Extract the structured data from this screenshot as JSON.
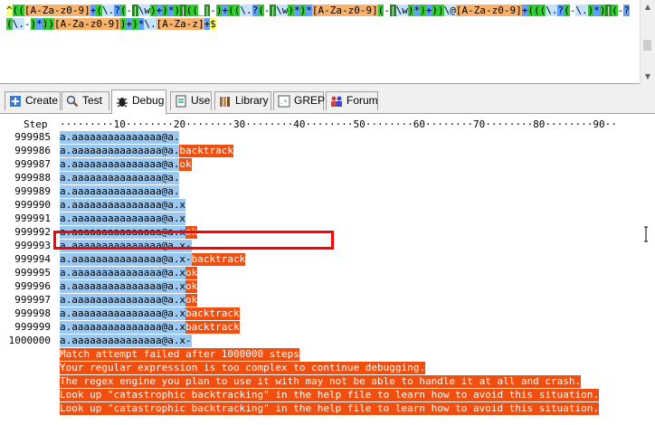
{
  "regex": {
    "tokens": [
      {
        "t": "^",
        "c": "t-anchor"
      },
      {
        "t": "(",
        "c": "t-grp"
      },
      {
        "t": "(",
        "c": "t-grp"
      },
      {
        "t": "[A-Za-z0-9]",
        "c": "t-cls"
      },
      {
        "t": "+",
        "c": "t-q"
      },
      {
        "t": "(",
        "c": "t-grp"
      },
      {
        "t": "\\.",
        "c": "t-esc"
      },
      {
        "t": "?",
        "c": "t-q"
      },
      {
        "t": "(",
        "c": "t-grp"
      },
      {
        "t": "-",
        "c": "t-lit"
      },
      {
        "t": "|",
        "c": "t-alt"
      },
      {
        "t": "\\w",
        "c": "t-esc"
      },
      {
        "t": ")",
        "c": "t-grp"
      },
      {
        "t": "+",
        "c": "t-q"
      },
      {
        "t": ")",
        "c": "t-grp"
      },
      {
        "t": "*",
        "c": "t-q"
      },
      {
        "t": ")",
        "c": "t-grp"
      },
      {
        "t": "|",
        "c": "t-alt"
      },
      {
        "t": "(",
        "c": "t-grp"
      },
      {
        "t": "(",
        "c": "t-grp"
      },
      {
        "t": "_",
        "c": "t-lit"
      },
      {
        "t": "|",
        "c": "t-alt"
      },
      {
        "t": "-",
        "c": "t-lit"
      },
      {
        "t": ")",
        "c": "t-grp"
      },
      {
        "t": "+",
        "c": "t-q"
      },
      {
        "t": "(",
        "c": "t-grp"
      },
      {
        "t": "(",
        "c": "t-grp"
      },
      {
        "t": "\\.",
        "c": "t-esc"
      },
      {
        "t": "?",
        "c": "t-q"
      },
      {
        "t": "(",
        "c": "t-grp"
      },
      {
        "t": "-",
        "c": "t-lit"
      },
      {
        "t": "|",
        "c": "t-alt"
      },
      {
        "t": "\\w",
        "c": "t-esc"
      },
      {
        "t": ")",
        "c": "t-grp"
      },
      {
        "t": "*",
        "c": "t-q"
      },
      {
        "t": ")",
        "c": "t-grp"
      },
      {
        "t": "*",
        "c": "t-q"
      },
      {
        "t": "[A-Za-z0-9]",
        "c": "t-cls"
      },
      {
        "t": "(",
        "c": "t-grp"
      },
      {
        "t": "-",
        "c": "t-lit"
      },
      {
        "t": "|",
        "c": "t-alt"
      },
      {
        "t": "\\w",
        "c": "t-esc"
      },
      {
        "t": ")",
        "c": "t-grp"
      },
      {
        "t": "*",
        "c": "t-q"
      },
      {
        "t": ")",
        "c": "t-grp"
      },
      {
        "t": "+",
        "c": "t-q"
      },
      {
        "t": ")",
        "c": "t-grp"
      },
      {
        "t": ")",
        "c": "t-grp"
      },
      {
        "t": "\\@",
        "c": "t-esc"
      },
      {
        "t": "[A-Za-z0-9]",
        "c": "t-cls"
      },
      {
        "t": "+",
        "c": "t-q"
      },
      {
        "t": "(",
        "c": "t-grp"
      },
      {
        "t": "(",
        "c": "t-grp"
      },
      {
        "t": "(",
        "c": "t-grp"
      },
      {
        "t": "\\.",
        "c": "t-esc"
      },
      {
        "t": "?",
        "c": "t-q"
      },
      {
        "t": "(",
        "c": "t-grp"
      },
      {
        "t": "-",
        "c": "t-lit"
      },
      {
        "t": "\\.",
        "c": "t-esc"
      },
      {
        "t": ")",
        "c": "t-grp"
      },
      {
        "t": "*",
        "c": "t-q"
      },
      {
        "t": ")",
        "c": "t-grp"
      },
      {
        "t": "|",
        "c": "t-alt"
      },
      {
        "t": "(",
        "c": "t-grp"
      },
      {
        "t": "-",
        "c": "t-lit"
      },
      {
        "t": "?",
        "c": "t-q"
      },
      {
        "t": "(",
        "c": "t-grp"
      },
      {
        "t": "\\.",
        "c": "t-esc"
      },
      {
        "t": "-",
        "c": "t-lit"
      },
      {
        "t": ")",
        "c": "t-grp"
      },
      {
        "t": "*",
        "c": "t-q"
      },
      {
        "t": ")",
        "c": "t-grp"
      },
      {
        "t": ")",
        "c": "t-grp"
      },
      {
        "t": "[A-Za-z0-9]",
        "c": "t-cls"
      },
      {
        "t": ")",
        "c": "t-grp"
      },
      {
        "t": "+",
        "c": "t-q"
      },
      {
        "t": ")",
        "c": "t-grp"
      },
      {
        "t": "*",
        "c": "t-q"
      },
      {
        "t": "\\.",
        "c": "t-esc"
      },
      {
        "t": "[A-Za-z]",
        "c": "t-cls"
      },
      {
        "t": "+",
        "c": "t-q"
      },
      {
        "t": "$",
        "c": "t-anchor"
      }
    ]
  },
  "tabs": [
    {
      "label": "Create",
      "icon": "create-icon",
      "active": false
    },
    {
      "label": "Test",
      "icon": "magnifier-icon",
      "active": false
    },
    {
      "label": "Debug",
      "icon": "bug-icon",
      "active": true
    },
    {
      "label": "Use",
      "icon": "use-icon",
      "active": false
    },
    {
      "label": "Library",
      "icon": "library-icon",
      "active": false
    },
    {
      "label": "GREP",
      "icon": "grep-icon",
      "active": false
    },
    {
      "label": "Forum",
      "icon": "forum-icon",
      "active": false
    }
  ],
  "debug": {
    "step_header": "Step",
    "ruler": "·········10········20········30········40········50········60········70········80········90··",
    "rows": [
      {
        "step": "999985",
        "text": "a.aaaaaaaaaaaaaaa@a.",
        "tail": "",
        "status": ""
      },
      {
        "step": "999986",
        "text": "a.aaaaaaaaaaaaaaa@a.",
        "tail": "",
        "status": "backtrack"
      },
      {
        "step": "999987",
        "text": "a.aaaaaaaaaaaaaaa@a.",
        "tail": "",
        "status": "ok"
      },
      {
        "step": "999988",
        "text": "a.aaaaaaaaaaaaaaa@a.",
        "tail": "",
        "status": ""
      },
      {
        "step": "999989",
        "text": "a.aaaaaaaaaaaaaaa@a.",
        "tail": "",
        "status": ""
      },
      {
        "step": "999990",
        "text": "a.aaaaaaaaaaaaaaa@a.",
        "tail": "x",
        "status": ""
      },
      {
        "step": "999991",
        "text": "a.aaaaaaaaaaaaaaa@a.",
        "tail": "x",
        "status": ""
      },
      {
        "step": "999992",
        "text": "a.aaaaaaaaaaaaaaa@a.",
        "tail": "x",
        "status": "ok"
      },
      {
        "step": "999993",
        "text": "a.aaaaaaaaaaaaaaa@a.",
        "tail": "x-",
        "status": ""
      },
      {
        "step": "999994",
        "text": "a.aaaaaaaaaaaaaaa@a.",
        "tail": "x-",
        "status": "backtrack"
      },
      {
        "step": "999995",
        "text": "a.aaaaaaaaaaaaaaa@a.",
        "tail": "x",
        "status": "ok"
      },
      {
        "step": "999996",
        "text": "a.aaaaaaaaaaaaaaa@a.",
        "tail": "x",
        "status": "ok"
      },
      {
        "step": "999997",
        "text": "a.aaaaaaaaaaaaaaa@a.",
        "tail": "x",
        "status": "ok"
      },
      {
        "step": "999998",
        "text": "a.aaaaaaaaaaaaaaa@a.",
        "tail": "x",
        "status": "backtrack"
      },
      {
        "step": "999999",
        "text": "a.aaaaaaaaaaaaaaa@a.",
        "tail": "x",
        "status": "backtrack"
      },
      {
        "step": "1000000",
        "text": "a.aaaaaaaaaaaaaaa@a.",
        "tail": "x-",
        "status": ""
      }
    ],
    "messages": [
      "Match attempt failed after 1000000 steps",
      "Your regular expression is too complex to continue debugging.",
      "The regex engine you plan to use it with may not be able to handle it at all and crash.",
      "Look up \"catastrophic backtracking\" in the help file to learn how to avoid this situation.",
      "Look up \"catastrophic backtracking\" in the help file to learn how to avoid this situation."
    ]
  },
  "colors": {
    "selection": "#9bc8f0",
    "message_bg": "#f04f0f",
    "highlight_border": "#ff0000"
  }
}
